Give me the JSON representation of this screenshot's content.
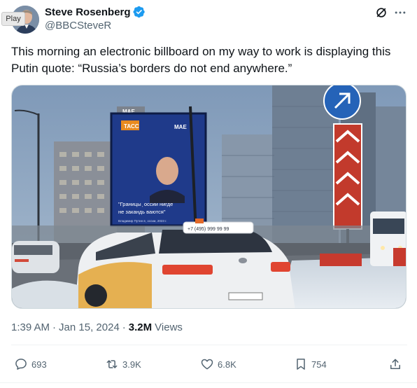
{
  "author": {
    "display_name": "Steve Rosenberg",
    "handle": "@BBCSteveR",
    "verified": true,
    "avatar_badge": "Play"
  },
  "tweet": {
    "text": "This morning an electronic billboard on my way to work is displaying this Putin quote: “Russia’s borders do not end anywhere.”"
  },
  "media": {
    "billboard_brand_left": "ТАСС",
    "billboard_brand_right": "МАЕ",
    "billboard_quote_line1": "\"Границы ᷊ оссии нигде",
    "billboard_quote_line2": "не закандь ваются\"",
    "billboard_caption": "Владимир Путин в ᷊ оссии, 2023 г.",
    "building_sign": "МАЕ",
    "taxi_roof_phone": "+7 (495) 999 99 99",
    "colors": {
      "sky": "#8ea8c4",
      "billboard": "#1f3a8a",
      "taxi": "#eef0f2",
      "snow": "#e6ebf0"
    }
  },
  "meta": {
    "time": "1:39 AM",
    "separator": "·",
    "date": "Jan 15, 2024",
    "views_count": "3.2M",
    "views_label": "Views"
  },
  "actions": {
    "replies": "693",
    "reposts": "3.9K",
    "likes": "6.8K",
    "bookmarks": "754"
  },
  "colors": {
    "text_primary": "#0f1419",
    "text_secondary": "#536471",
    "verified_blue": "#1d9bf0",
    "divider": "#eff3f4"
  }
}
